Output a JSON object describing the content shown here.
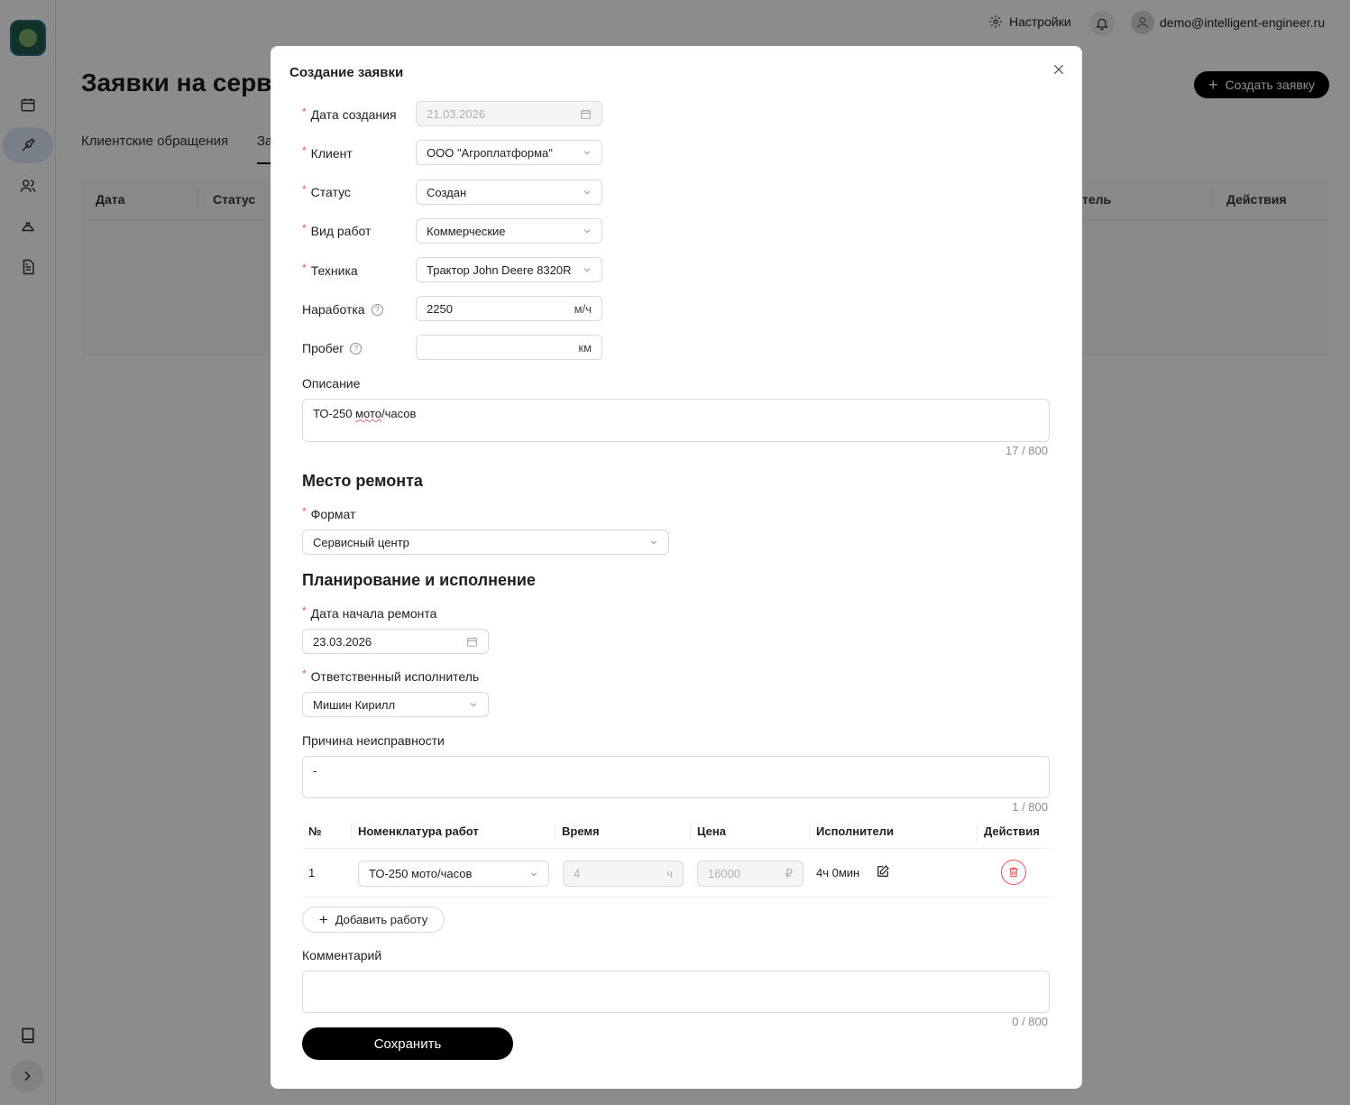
{
  "header": {
    "settings_label": "Настройки",
    "user_email": "demo@intelligent-engineer.ru"
  },
  "page": {
    "title": "Заявки на серви",
    "create_button": "Создать заявку",
    "tabs": [
      {
        "label": "Клиентские обращения"
      },
      {
        "label": "За"
      }
    ],
    "table_headers": {
      "date": "Дата",
      "status": "Статус",
      "executor_partial": "тель",
      "actions": "Действия"
    }
  },
  "modal": {
    "title": "Создание заявки",
    "fields": {
      "created_date": {
        "label": "Дата создания",
        "value": "21.03.2026"
      },
      "client": {
        "label": "Клиент",
        "value": "ООО \"Агроплатформа\""
      },
      "status": {
        "label": "Статус",
        "value": "Создан"
      },
      "work_type": {
        "label": "Вид работ",
        "value": "Коммерческие"
      },
      "machinery": {
        "label": "Техника",
        "value": "Трактор John Deere 8320R"
      },
      "operating_hours": {
        "label": "Наработка",
        "value": "2250",
        "unit": "м/ч"
      },
      "mileage": {
        "label": "Пробег",
        "value": "",
        "unit": "км"
      }
    },
    "description": {
      "label": "Описание",
      "value_prefix": "ТО-250 ",
      "value_mid": "мото",
      "value_suffix": "/часов",
      "counter": "17 / 800"
    },
    "repair_place": {
      "section_title": "Место ремонта",
      "format_label": "Формат",
      "format_value": "Сервисный центр"
    },
    "planning": {
      "section_title": "Планирование и исполнение",
      "start_date_label": "Дата начала ремонта",
      "start_date_value": "23.03.2026",
      "executor_label": "Ответственный исполнитель",
      "executor_value": "Мишин Кирилл",
      "fault_reason_label": "Причина неисправности",
      "fault_reason_value": "-",
      "fault_reason_counter": "1 / 800"
    },
    "works_table": {
      "headers": [
        "№",
        "Номенклатура работ",
        "Время",
        "Цена",
        "Исполнители",
        "Действия"
      ],
      "rows": [
        {
          "num": "1",
          "name": "ТО-250 мото/часов",
          "time": "4",
          "time_unit": "ч",
          "price": "16000",
          "price_unit": "₽",
          "executors": "4ч 0мин"
        }
      ],
      "add_button": "Добавить работу"
    },
    "comment": {
      "label": "Комментарий",
      "value": "",
      "counter": "0 / 800"
    },
    "save_button": "Сохранить"
  }
}
